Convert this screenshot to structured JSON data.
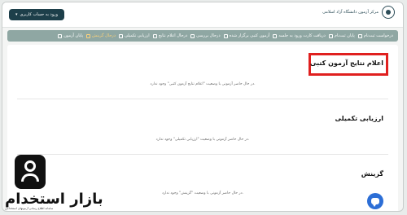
{
  "topbar": {
    "login_button_label": "ورود به حساب کاربری",
    "logo_title": "مرکز آزمون دانشگاه آزاد اسلامی"
  },
  "nav": {
    "items": [
      {
        "label": "درخواست ثبت‌نام",
        "icon": "document-icon",
        "active": false
      },
      {
        "label": "پایان ثبت‌نام",
        "icon": "check-icon",
        "active": false
      },
      {
        "label": "دریافت کارت ورود به جلسه",
        "icon": "card-icon",
        "active": false
      },
      {
        "label": "آزمون کتبی برگزار شده",
        "icon": "edit-icon",
        "active": false
      },
      {
        "label": "درحال بررسی",
        "icon": "folder-icon",
        "active": false
      },
      {
        "label": "درحال اعلام نتایج",
        "icon": "megaphone-icon",
        "active": false
      },
      {
        "label": "ارزیابی تکمیلی",
        "icon": "clipboard-icon",
        "active": false
      },
      {
        "label": "درحال گزینش",
        "icon": "filter-icon",
        "active": true
      },
      {
        "label": "پایان آزمون",
        "icon": "flag-icon",
        "active": false
      }
    ]
  },
  "sections": [
    {
      "title": "اعلام نتایج آزمون کتبی",
      "message": "در حال حاضر آزمونی با وضعیت \"اعلام نتایج آزمون کتبی\" وجود ندارد."
    },
    {
      "title": "ارزیابی تکمیلی",
      "message": "در حال حاضر آزمونی با وضعیت \"ارزیابی تکمیلی\" وجود ندارد."
    },
    {
      "title": "گزینش",
      "message": "در حال حاضر آزمونی با وضعیت \"گزینش\" وجود ندارد."
    }
  ],
  "watermark": {
    "brand": "بازار استخدام",
    "sub": "سامانه اطلاع رسانی آزمونهای استخدامی"
  },
  "colors": {
    "nav_bg": "#8fa7a3",
    "login_bg": "#1d3f4a",
    "highlight": "#e0201f",
    "chat_fab": "#2c6ed6",
    "active_nav": "#ffd37a"
  },
  "chat_button": {
    "icon": "chat-icon"
  }
}
